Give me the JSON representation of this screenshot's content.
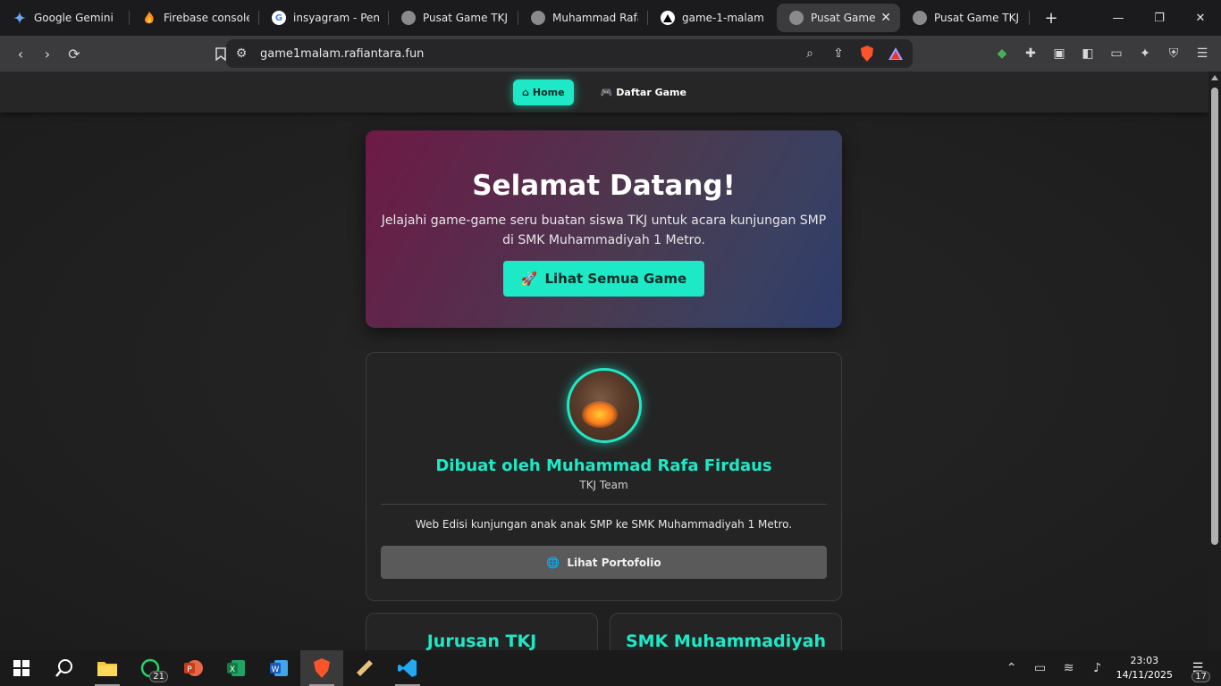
{
  "browser": {
    "tabs": [
      {
        "title": "Google Gemini",
        "favicon": "gemini-icon",
        "active": false
      },
      {
        "title": "Firebase console",
        "favicon": "firebase-icon",
        "active": false
      },
      {
        "title": "insyagram - Penel",
        "favicon": "google-icon",
        "active": false
      },
      {
        "title": "Pusat Game TKJ -",
        "favicon": "globe-icon",
        "active": false
      },
      {
        "title": "Muhammad Rafa",
        "favicon": "globe-icon",
        "active": false
      },
      {
        "title": "game-1-malam -",
        "favicon": "vercel-icon",
        "active": false
      },
      {
        "title": "Pusat Game T",
        "favicon": "globe-icon",
        "active": true
      },
      {
        "title": "Pusat Game TKJ -",
        "favicon": "globe-icon",
        "active": false
      }
    ],
    "url": "game1malam.rafiantara.fun",
    "accent": "#1de9c7"
  },
  "site": {
    "nav": {
      "home": "Home",
      "games": "Daftar Game"
    },
    "hero": {
      "title": "Selamat Datang!",
      "subtitle": "Jelajahi game-game seru buatan siswa TKJ untuk acara kunjungan SMP di SMK Muhammadiyah 1 Metro.",
      "cta": "Lihat Semua Game"
    },
    "profile": {
      "name": "Dibuat oleh Muhammad Rafa Firdaus",
      "team": "TKJ Team",
      "description": "Web Edisi kunjungan anak anak SMP ke SMK Muhammadiyah 1 Metro.",
      "portfolio_button": "Lihat Portofolio"
    },
    "cards": [
      {
        "title": "Jurusan TKJ"
      },
      {
        "title": "SMK Muhammadiyah"
      }
    ]
  },
  "taskbar": {
    "whatsapp_badge": "21",
    "time": "23:03",
    "date": "14/11/2025",
    "notification_count": "17"
  }
}
